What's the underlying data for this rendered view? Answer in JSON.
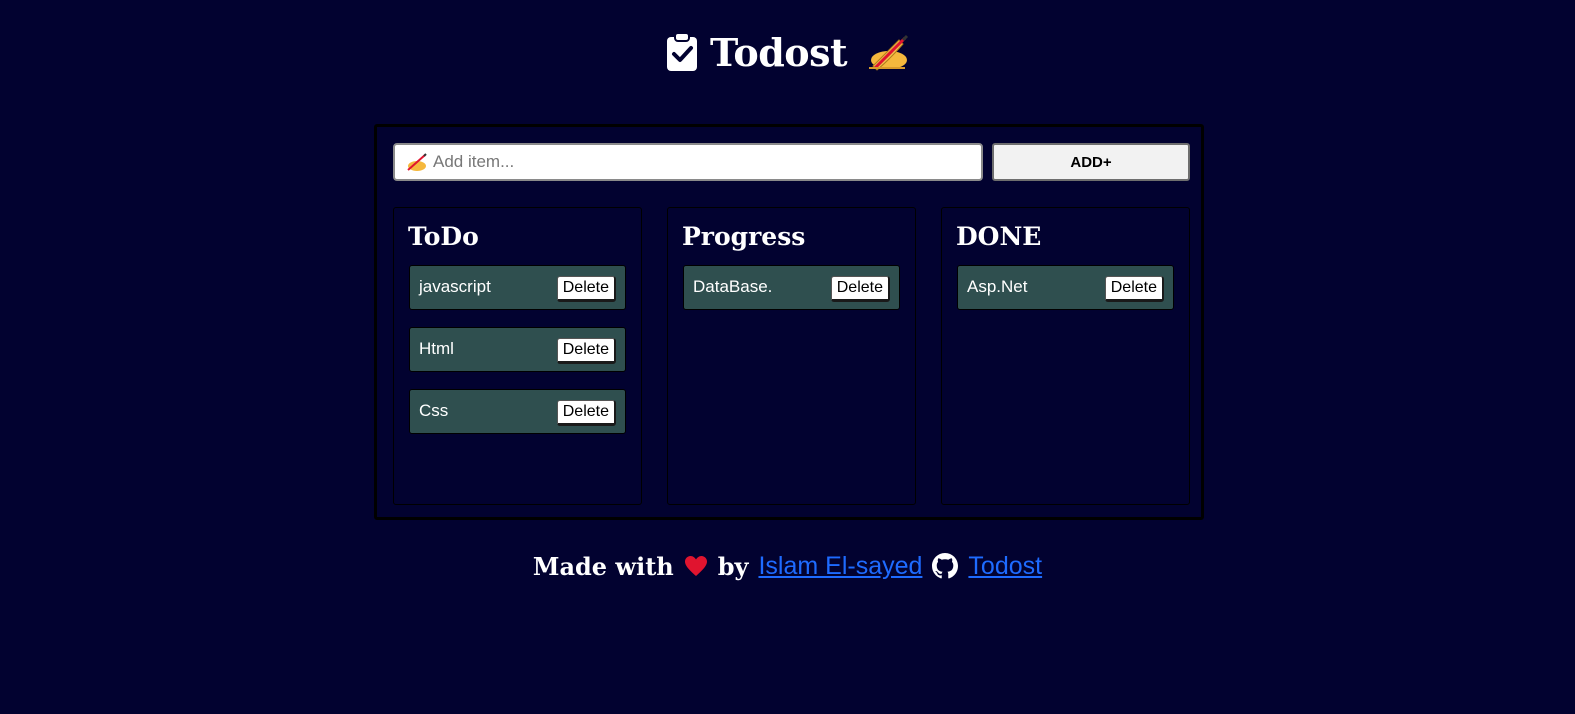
{
  "header": {
    "title": "Todost",
    "left_icon": "clipboard-check-icon",
    "right_icon": "writing-hand-icon"
  },
  "input": {
    "placeholder": "Add item...",
    "value": "",
    "icon": "writing-hand-icon"
  },
  "add_button": {
    "label": "ADD+"
  },
  "columns": [
    {
      "title": "ToDo",
      "items": [
        {
          "text": "javascript",
          "delete_label": "Delete"
        },
        {
          "text": "Html",
          "delete_label": "Delete"
        },
        {
          "text": "Css",
          "delete_label": "Delete"
        }
      ]
    },
    {
      "title": "Progress",
      "items": [
        {
          "text": "DataBase.",
          "delete_label": "Delete"
        }
      ]
    },
    {
      "title": "DONE",
      "items": [
        {
          "text": "Asp.Net",
          "delete_label": "Delete"
        }
      ]
    }
  ],
  "footer": {
    "made_with": "Made with",
    "by": "by",
    "author_link": "Islam El-sayed",
    "repo_link": "Todost",
    "heart_icon": "heart-icon",
    "github_icon": "github-icon"
  },
  "colors": {
    "background": "#020230",
    "item_background": "#2f4f4f",
    "link": "#1e6bff",
    "heart": "#e0142f"
  }
}
